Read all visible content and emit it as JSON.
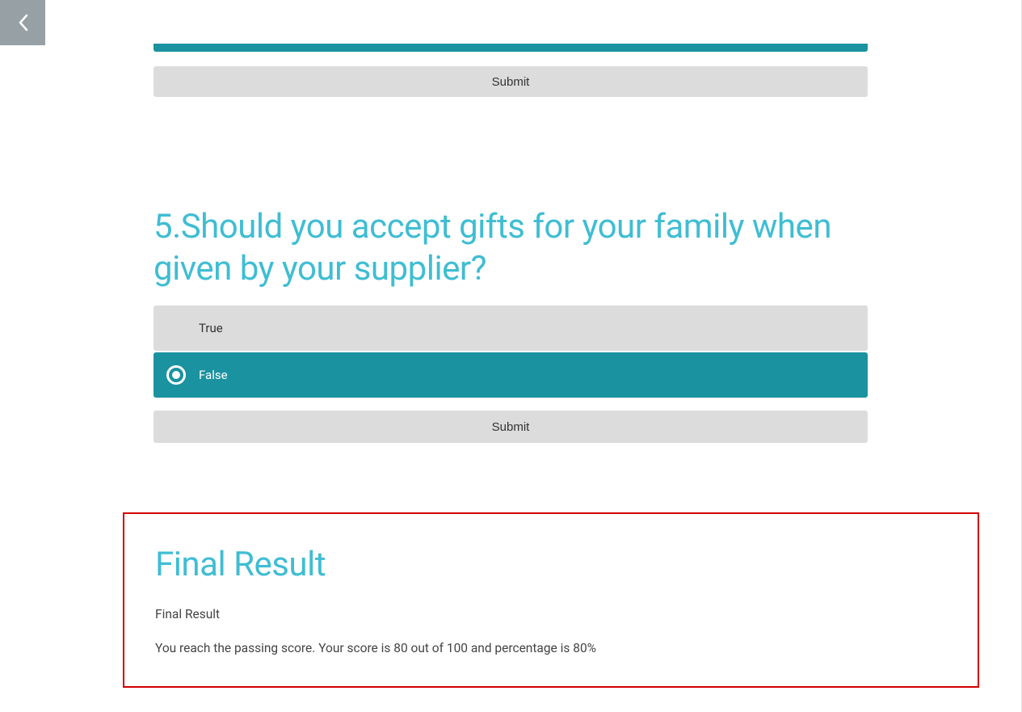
{
  "top_section": {
    "submit_label": "Submit"
  },
  "question5": {
    "number": "5",
    "text": "Should you accept gifts for your family when given by your supplier?",
    "options": [
      {
        "label": "True",
        "selected": false
      },
      {
        "label": "False",
        "selected": true
      }
    ],
    "submit_label": "Submit"
  },
  "result": {
    "title": "Final Result",
    "subtitle": "Final Result",
    "message": "You reach the passing score. Your score is 80 out of 100 and percentage is 80%"
  }
}
